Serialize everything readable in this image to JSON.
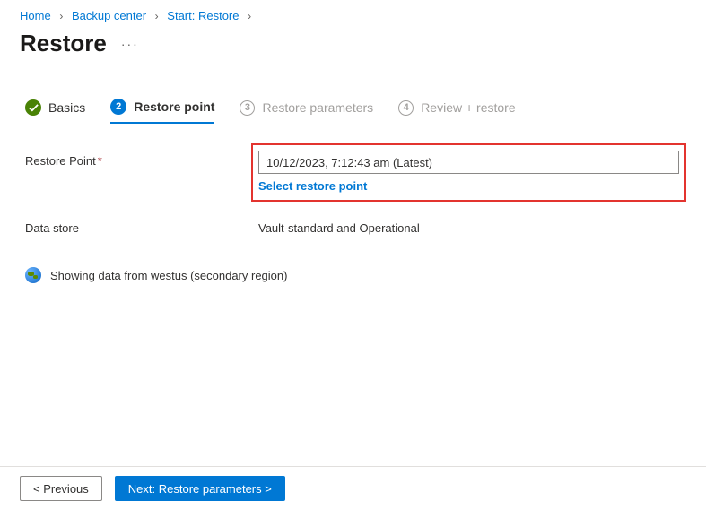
{
  "breadcrumb": {
    "items": [
      "Home",
      "Backup center",
      "Start: Restore"
    ]
  },
  "page": {
    "title": "Restore"
  },
  "tabs": {
    "basics": "Basics",
    "restore_point": "Restore point",
    "restore_parameters": "Restore parameters",
    "review": "Review + restore",
    "step2": "2",
    "step3": "3",
    "step4": "4"
  },
  "form": {
    "restore_point_label": "Restore Point",
    "restore_point_value": "10/12/2023, 7:12:43 am (Latest)",
    "select_link": "Select restore point",
    "data_store_label": "Data store",
    "data_store_value": "Vault-standard and Operational"
  },
  "region_note": "Showing data from westus (secondary region)",
  "footer": {
    "prev": "< Previous",
    "next": "Next: Restore parameters >"
  }
}
